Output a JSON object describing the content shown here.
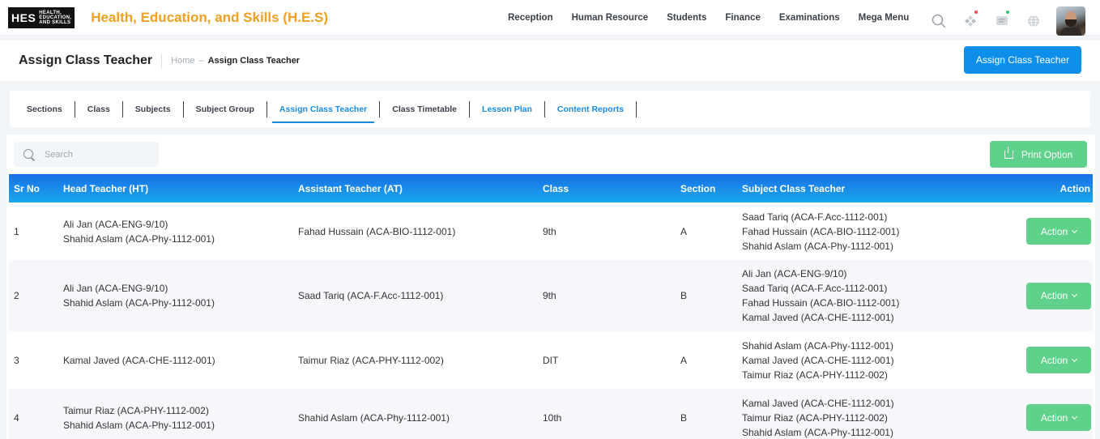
{
  "app": {
    "logo_mark": "HES",
    "logo_lines": [
      "HEALTH,",
      "EDUCATION,",
      "AND SKILLS"
    ],
    "title": "Health, Education, and Skills (H.E.S)"
  },
  "topnav": [
    "Reception",
    "Human Resource",
    "Students",
    "Finance",
    "Examinations",
    "Mega Menu"
  ],
  "header_icons": [
    "search-icon",
    "apps-icon",
    "chat-icon",
    "globe-icon"
  ],
  "page": {
    "title": "Assign Class Teacher",
    "breadcrumb": {
      "home": "Home",
      "separator": "–",
      "current": "Assign Class Teacher"
    },
    "primary_button": "Assign Class Teacher"
  },
  "tabs": [
    {
      "label": "Sections",
      "style": "default"
    },
    {
      "label": "Class",
      "style": "default"
    },
    {
      "label": "Subjects",
      "style": "default"
    },
    {
      "label": "Subject Group",
      "style": "default"
    },
    {
      "label": "Assign Class Teacher",
      "style": "active"
    },
    {
      "label": "Class Timetable",
      "style": "default"
    },
    {
      "label": "Lesson Plan",
      "style": "blue"
    },
    {
      "label": "Content Reports",
      "style": "blue"
    }
  ],
  "search": {
    "placeholder": "Search",
    "value": ""
  },
  "print_button": "Print Option",
  "table": {
    "headers": [
      "Sr No",
      "Head Teacher (HT)",
      "Assistant Teacher (AT)",
      "Class",
      "Section",
      "Subject Class Teacher",
      "Action"
    ],
    "rows": [
      {
        "sr": "1",
        "head_teachers": [
          "Ali Jan (ACA-ENG-9/10)",
          "Shahid Aslam (ACA-Phy-1112-001)"
        ],
        "assistant": "Fahad Hussain (ACA-BIO-1112-001)",
        "class": "9th",
        "section": "A",
        "subject_teachers": [
          "Saad Tariq (ACA-F.Acc-1112-001)",
          "Fahad Hussain (ACA-BIO-1112-001)",
          "Shahid Aslam (ACA-Phy-1112-001)"
        ],
        "action": "Action"
      },
      {
        "sr": "2",
        "head_teachers": [
          "Ali Jan (ACA-ENG-9/10)",
          "Shahid Aslam (ACA-Phy-1112-001)"
        ],
        "assistant": "Saad Tariq (ACA-F.Acc-1112-001)",
        "class": "9th",
        "section": "B",
        "subject_teachers": [
          "Ali Jan (ACA-ENG-9/10)",
          "Saad Tariq (ACA-F.Acc-1112-001)",
          "Fahad Hussain (ACA-BIO-1112-001)",
          "Kamal Javed (ACA-CHE-1112-001)"
        ],
        "action": "Action"
      },
      {
        "sr": "3",
        "head_teachers": [
          "Kamal Javed (ACA-CHE-1112-001)"
        ],
        "assistant": "Taimur Riaz (ACA-PHY-1112-002)",
        "class": "DIT",
        "section": "A",
        "subject_teachers": [
          "Shahid Aslam (ACA-Phy-1112-001)",
          "Kamal Javed (ACA-CHE-1112-001)",
          "Taimur Riaz (ACA-PHY-1112-002)"
        ],
        "action": "Action"
      },
      {
        "sr": "4",
        "head_teachers": [
          "Taimur Riaz (ACA-PHY-1112-002)",
          "Shahid Aslam (ACA-Phy-1112-001)"
        ],
        "assistant": "Shahid Aslam (ACA-Phy-1112-001)",
        "class": "10th",
        "section": "B",
        "subject_teachers": [
          "Kamal Javed (ACA-CHE-1112-001)",
          "Taimur Riaz (ACA-PHY-1112-002)",
          "Shahid Aslam (ACA-Phy-1112-001)"
        ],
        "action": "Action"
      }
    ]
  },
  "colors": {
    "title_orange": "#f0a020",
    "primary_blue": "#0d8fe9",
    "success_green": "#5fd18a",
    "header_gradient_start": "#1a6fe8",
    "header_gradient_end": "#18a8ea"
  }
}
